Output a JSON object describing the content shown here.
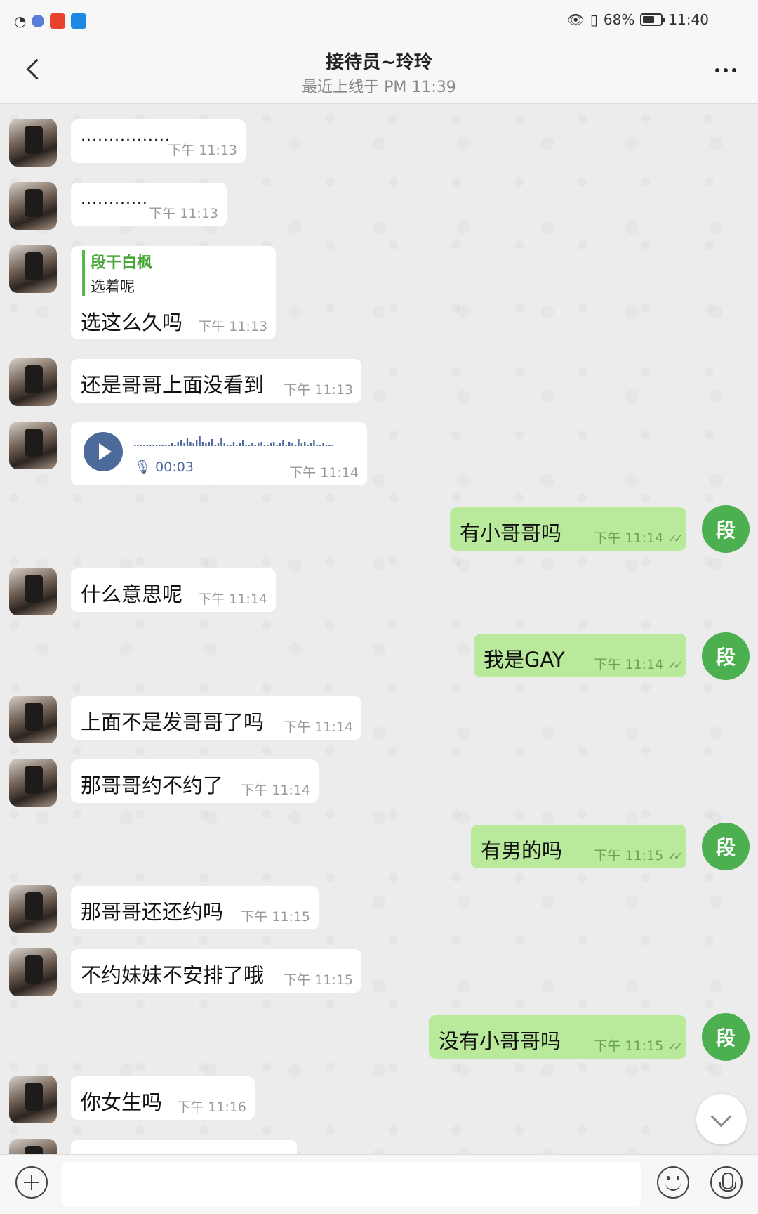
{
  "status_bar": {
    "battery": "68%",
    "battery_level": 0.68,
    "time": "11:40"
  },
  "header": {
    "title": "接待员~玲玲",
    "subtitle": "最近上线于 PM 11:39"
  },
  "messages": [
    {
      "type": "text",
      "dir": "in",
      "text": "················",
      "time": "下午 11:13"
    },
    {
      "type": "text",
      "dir": "in",
      "text": "············",
      "time": "下午 11:13"
    },
    {
      "type": "reply",
      "dir": "in",
      "quote_name": "段干白枫",
      "quote_text": "选着呢",
      "text": "选这么久吗",
      "time": "下午 11:13"
    },
    {
      "type": "text",
      "dir": "in",
      "text": "还是哥哥上面没看到",
      "time": "下午 11:13"
    },
    {
      "type": "voice",
      "dir": "in",
      "duration": "00:03",
      "time": "下午 11:14"
    },
    {
      "type": "text",
      "dir": "out",
      "text": "有小哥哥吗",
      "time": "下午 11:14"
    },
    {
      "type": "text",
      "dir": "in",
      "text": "什么意思呢",
      "time": "下午 11:14"
    },
    {
      "type": "text",
      "dir": "out",
      "text": "我是GAY",
      "time": "下午 11:14"
    },
    {
      "type": "text",
      "dir": "in",
      "text": "上面不是发哥哥了吗",
      "time": "下午 11:14"
    },
    {
      "type": "text",
      "dir": "in",
      "text": "那哥哥约不约了",
      "time": "下午 11:14"
    },
    {
      "type": "text",
      "dir": "out",
      "text": "有男的吗",
      "time": "下午 11:15"
    },
    {
      "type": "text",
      "dir": "in",
      "text": "那哥哥还还约吗",
      "time": "下午 11:15"
    },
    {
      "type": "text",
      "dir": "in",
      "text": "不约妹妹不安排了哦",
      "time": "下午 11:15"
    },
    {
      "type": "text",
      "dir": "out",
      "text": "没有小哥哥吗",
      "time": "下午 11:15"
    },
    {
      "type": "text",
      "dir": "in",
      "text": "你女生吗",
      "time": "下午 11:16"
    }
  ],
  "me_avatar_label": "段",
  "input": {
    "placeholder": ""
  },
  "icons": {
    "back": "back-arrow-icon",
    "more": "more-dots-icon",
    "play": "play-icon",
    "mic_small": "mic-icon",
    "check": "double-check-icon",
    "scroll": "chevron-down-icon",
    "plus": "plus-icon",
    "emoji": "emoji-icon",
    "voice": "microphone-icon"
  },
  "colors": {
    "outgoing_bubble": "#b9e99a",
    "accent_green": "#4caf50",
    "voice_accent": "#4d6b9a"
  }
}
